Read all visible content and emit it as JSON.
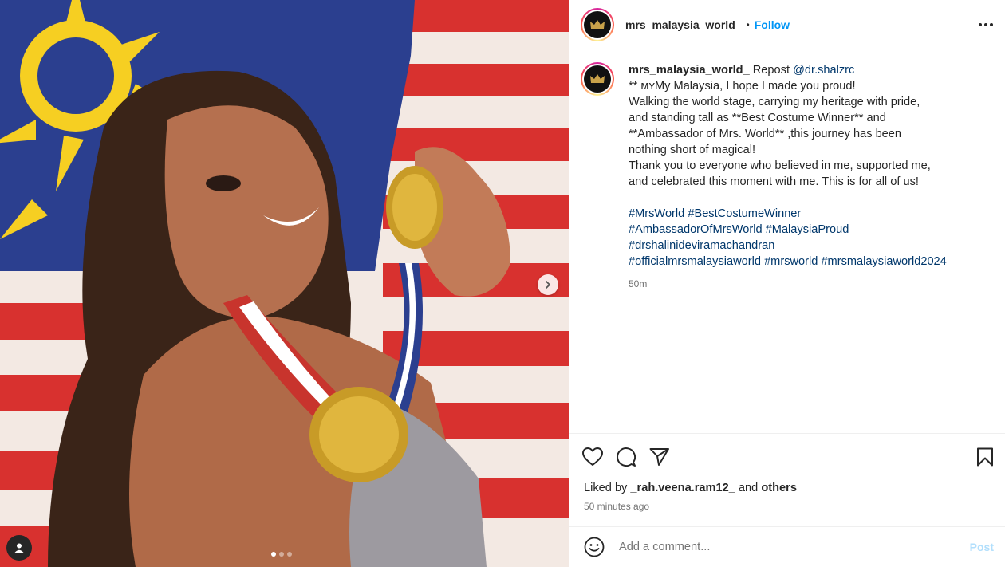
{
  "post": {
    "username": "mrs_malaysia_world_",
    "separator": "•",
    "follow_label": "Follow",
    "more_icon": "more-horizontal-icon"
  },
  "caption": {
    "username": "mrs_malaysia_world_",
    "repost_text": "Repost",
    "mention": "@dr.shalzrc",
    "lines": [
      "** ᴍʏMy Malaysia, I hope I made you proud!",
      "Walking the world stage, carrying my heritage with pride,",
      "and standing tall as **Best Costume Winner** and",
      "**Ambassador of Mrs. World** ,this journey has been",
      "nothing short of magical!",
      "Thank you to everyone who believed in me, supported me,",
      "and celebrated this moment with me. This is for all of us!"
    ],
    "hashtags": {
      "h1": "#MrsWorld",
      "h2": "#BestCostumeWinner",
      "h3": "#AmbassadorOfMrsWorld",
      "h4": "#MalaysiaProud",
      "h5": "#drshalinideviramachandran",
      "h6": "#officialmrsmalaysiaworld",
      "h7": "#mrsworld",
      "h8": "#mrsmalaysiaworld2024"
    },
    "time": "50m"
  },
  "likes": {
    "prefix": "Liked by",
    "user": "_rah.veena.ram12_",
    "and": "and",
    "others": "others"
  },
  "post_time": "50 minutes ago",
  "comment": {
    "placeholder": "Add a comment...",
    "post_label": "Post"
  },
  "carousel": {
    "current": 1,
    "total": 3
  },
  "colors": {
    "accent": "#0095f6",
    "link": "#00376b",
    "muted": "#737373",
    "post_disabled": "#b2dffc"
  }
}
